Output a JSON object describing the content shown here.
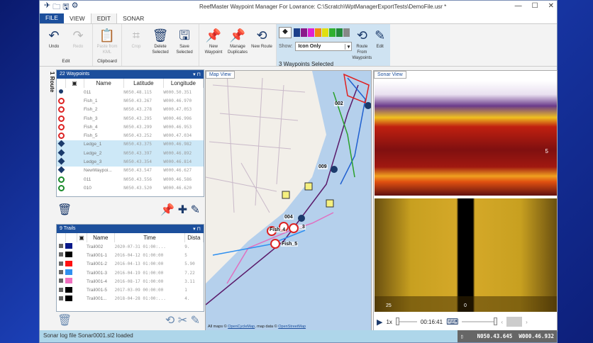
{
  "window": {
    "title": "ReefMaster Waypoint Manager For Lowrance: C:\\Scratch\\WptManagerExportTests\\DemoFile.usr *",
    "controls": [
      "—",
      "☐",
      "✕"
    ]
  },
  "tabs": [
    {
      "label": "FILE"
    },
    {
      "label": "VIEW"
    },
    {
      "label": "EDIT"
    },
    {
      "label": "SONAR"
    }
  ],
  "ribbon": {
    "edit_group": {
      "label": "Edit",
      "undo": "Undo",
      "redo": "Redo"
    },
    "clipboard_group": {
      "label": "Clipboard",
      "paste": "Paste from KML"
    },
    "crop": "Crop",
    "delete": "Delete Selected",
    "save": "Save Selected",
    "new_waypoint": "New Waypoint",
    "manage_duplicates": "Manage Duplicates",
    "new_route": "New Route",
    "selection_group": {
      "label": "3 Waypoints Selected",
      "show_label": "Show:",
      "show_value": "Icon Only",
      "route_from": "Route From Waypoints",
      "edit": "Edit",
      "swatches": [
        "#1c3f8a",
        "#8a1a8a",
        "#e020d0",
        "#f08a10",
        "#e0e010",
        "#30b030",
        "#238a3a",
        "#888888"
      ]
    }
  },
  "sidebar": {
    "route_tab": "1 Route"
  },
  "waypoints": {
    "header": "22 Waypoints",
    "columns": [
      "Name",
      "Latitude",
      "Longitude"
    ],
    "rows": [
      {
        "icon": "dot",
        "name": "011",
        "lat": "N050.48.115",
        "lon": "W000.50.351"
      },
      {
        "icon": "fish",
        "name": "Fish_1",
        "lat": "N050.43.267",
        "lon": "W000.46.970"
      },
      {
        "icon": "fish",
        "name": "Fish_2",
        "lat": "N050.43.278",
        "lon": "W000.47.053"
      },
      {
        "icon": "fish",
        "name": "Fish_3",
        "lat": "N050.43.295",
        "lon": "W000.46.996"
      },
      {
        "icon": "fish",
        "name": "Fish_4",
        "lat": "N050.43.299",
        "lon": "W000.46.953"
      },
      {
        "icon": "fish",
        "name": "Fish_5",
        "lat": "N050.43.252",
        "lon": "W000.47.034"
      },
      {
        "icon": "ledge",
        "name": "Ledge_1",
        "lat": "N050.43.375",
        "lon": "W000.46.982",
        "selected": true
      },
      {
        "icon": "ledge",
        "name": "Ledge_2",
        "lat": "N050.43.397",
        "lon": "W000.46.892",
        "selected": true
      },
      {
        "icon": "ledge",
        "name": "Ledge_3",
        "lat": "N050.43.354",
        "lon": "W000.46.814",
        "selected": true
      },
      {
        "icon": "ledge",
        "name": "NewWaypoi...",
        "lat": "N050.43.547",
        "lon": "W000.46.627"
      },
      {
        "icon": "green",
        "name": "011",
        "lat": "N050.43.556",
        "lon": "W000.46.586"
      },
      {
        "icon": "green",
        "name": "010",
        "lat": "N050.43.520",
        "lon": "W000.46.620"
      }
    ]
  },
  "trails": {
    "header": "9 Trails",
    "columns": [
      "Name",
      "Time",
      "Dista"
    ],
    "rows": [
      {
        "color": "#0a1a8a",
        "name": "Trail002",
        "time": "2020-07-31 01:00:...",
        "dist": "9."
      },
      {
        "color": "#000000",
        "name": "Trail001-1",
        "time": "2016-04-12 01:00:00",
        "dist": "5"
      },
      {
        "color": "#ff1010",
        "name": "Trail001-2",
        "time": "2016-04-13 01:00:00",
        "dist": "5.90"
      },
      {
        "color": "#3090f0",
        "name": "Trail001-3",
        "time": "2016-04-19 01:00:00",
        "dist": "7.22"
      },
      {
        "color": "#f070c0",
        "name": "Trail001-4",
        "time": "2016-08-17 01:00:00",
        "dist": "3.11"
      },
      {
        "color": "#000000",
        "name": "Trail001-5",
        "time": "2017-03-09 00:00:00",
        "dist": "1"
      },
      {
        "color": "#000000",
        "name": "Trail001...",
        "time": "2018-04-28 01:00:...",
        "dist": "4."
      }
    ]
  },
  "map": {
    "tab": "Map View",
    "labels": [
      "002",
      "009",
      "004",
      "Fish_4",
      "Fish_5",
      "_3"
    ],
    "attribution_prefix": "All maps © ",
    "link1": "OpenCycleMap",
    "attribution_mid": ", map data © ",
    "link2": "OpenStreetMap"
  },
  "sonar": {
    "tab": "Sonar View",
    "depth_label": "5",
    "scale_left": "25",
    "scale_center": "0",
    "speed": "1x",
    "time": "00:16:41"
  },
  "status": {
    "message": "Sonar log file Sonar0001.sl2 loaded",
    "lat": "N050.43.645",
    "lon": "W000.46.932"
  }
}
